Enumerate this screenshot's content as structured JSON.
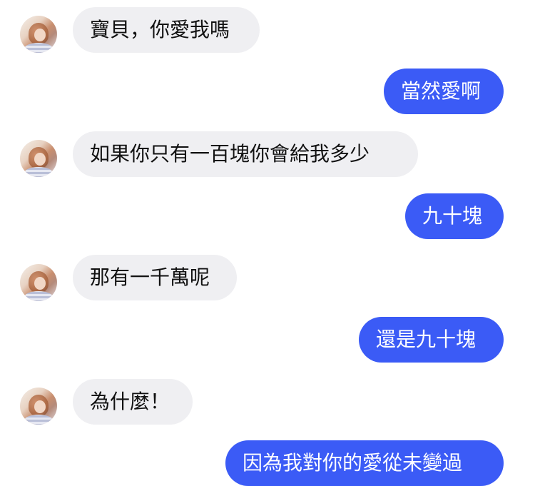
{
  "conversation": {
    "messages": [
      {
        "side": "received",
        "text": "寶貝，你愛我嗎"
      },
      {
        "side": "sent",
        "text": "當然愛啊"
      },
      {
        "side": "received",
        "text": "如果你只有一百塊你會給我多少"
      },
      {
        "side": "sent",
        "text": "九十塊"
      },
      {
        "side": "received",
        "text": "那有一千萬呢"
      },
      {
        "side": "sent",
        "text": "還是九十塊"
      },
      {
        "side": "received",
        "text": "為什麼！"
      },
      {
        "side": "sent",
        "text": "因為我對你的愛從未變過"
      }
    ]
  },
  "colors": {
    "sent_bubble": "#3b5bf6",
    "received_bubble": "#efeff2",
    "background": "#ffffff"
  }
}
